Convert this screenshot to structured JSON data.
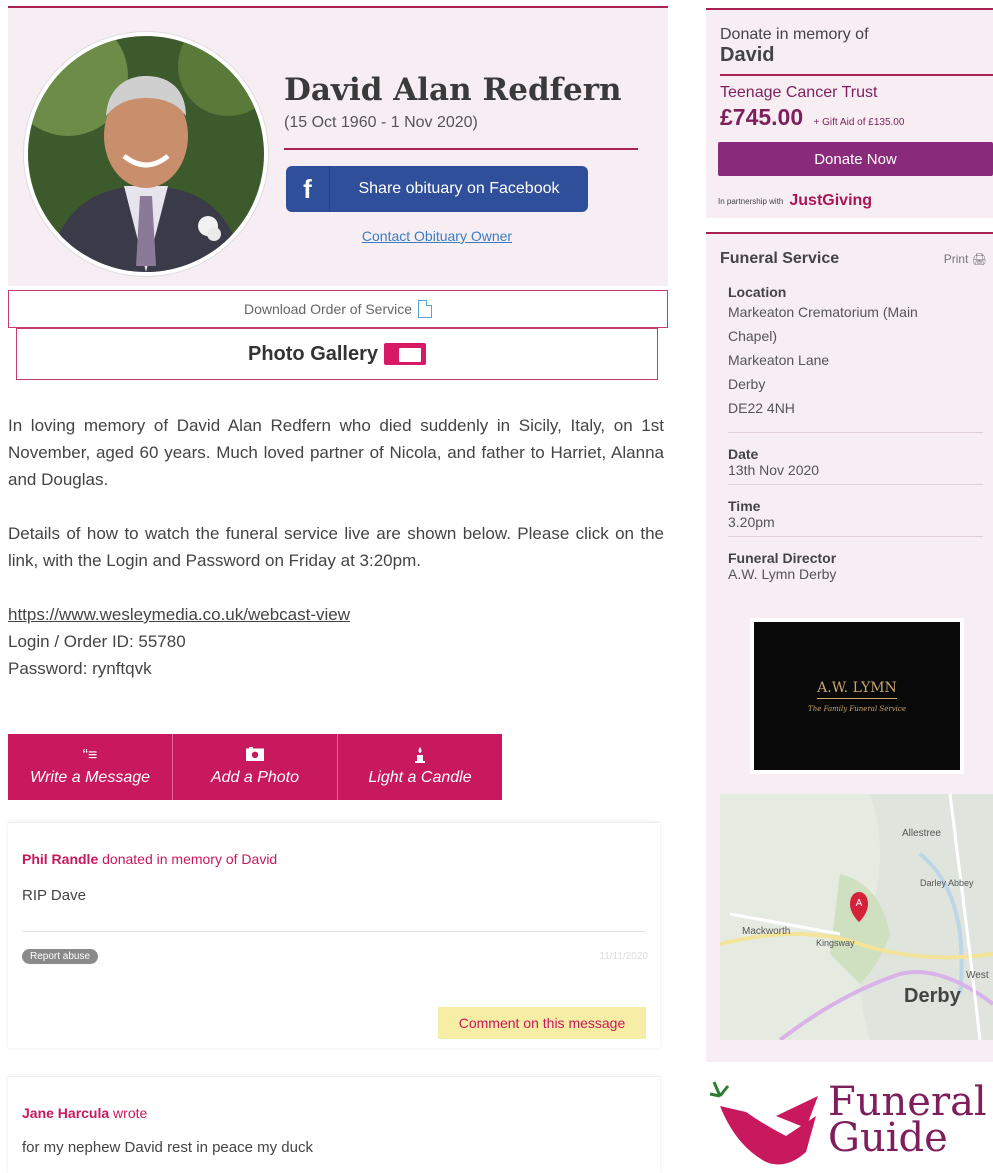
{
  "obituary": {
    "name": "David Alan Redfern",
    "dates": "(15 Oct 1960 - 1 Nov 2020)",
    "facebook_label": "Share obituary on Facebook",
    "contact_label": "Contact Obituary Owner",
    "download_label": "Download Order of Service",
    "gallery_label": "Photo Gallery"
  },
  "tribute": {
    "p1": "In loving memory of David Alan Redfern who died suddenly in Sicily, Italy, on 1st November, aged 60 years. Much loved partner of Nicola, and father to Harriet, Alanna and Douglas.",
    "p2": "Details of how to watch the funeral service live are shown below. Please click on the link, with the Login and Password on Friday at 3:20pm.",
    "link": "https://www.wesleymedia.co.uk/webcast-view",
    "login": "Login / Order ID: 55780",
    "password": "Password: rynftqvk"
  },
  "actions": [
    {
      "label": "Write a Message",
      "icon": "quote-icon"
    },
    {
      "label": "Add a Photo",
      "icon": "camera-icon"
    },
    {
      "label": "Light a Candle",
      "icon": "candle-icon"
    }
  ],
  "messages": [
    {
      "author": "Phil Randle",
      "action": " donated in memory of David",
      "text": "RIP Dave",
      "report_label": "Report abuse",
      "date": "11/11/2020",
      "comment_label": "Comment on this message"
    },
    {
      "author": "Jane Harcula",
      "action": " wrote",
      "text": "for my nephew David rest in peace my duck"
    }
  ],
  "donate": {
    "title": "Donate in memory of",
    "name": "David",
    "charity": "Teenage Cancer Trust",
    "amount": "£745.00",
    "gift_aid": "+ Gift Aid of £135.00",
    "button": "Donate Now",
    "partner": "In partnership with",
    "partner_brand": "JustGiving"
  },
  "service": {
    "title": "Funeral Service",
    "print": "Print",
    "location_label": "Location",
    "location_lines": [
      "Markeaton Crematorium (Main",
      "Chapel)",
      "Markeaton Lane",
      "Derby",
      "DE22 4NH"
    ],
    "date_label": "Date",
    "date": "13th Nov 2020",
    "time_label": "Time",
    "time": "3.20pm",
    "director_label": "Funeral Director",
    "director": "A.W. Lymn Derby",
    "logo_name": "A.W. LYMN",
    "logo_tagline": "The Family Funeral Service",
    "map_labels": [
      "Allestree",
      "Darley Abbey",
      "Mackworth",
      "Kingsway",
      "Derby",
      "West"
    ],
    "map_pin": "A"
  },
  "brand": {
    "line1": "Funeral",
    "line2": "Guide"
  },
  "colors": {
    "accent": "#c8185e",
    "maroon": "#a8234f",
    "facebook": "#2f4f9a",
    "donate": "#8a2a7b"
  }
}
